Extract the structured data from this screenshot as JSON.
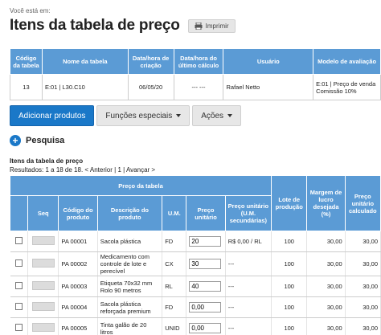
{
  "breadcrumb": "Você está em:",
  "page_title": "Itens da tabela de preço",
  "print_label": "Imprimir",
  "header_table": {
    "columns": [
      "Código da tabela",
      "Nome da tabela",
      "Data/hora de criação",
      "Data/hora do último cálculo",
      "Usuário",
      "Modelo de avaliação"
    ],
    "row": [
      "13",
      "E:01 | L30.C10",
      "06/05/20",
      "--- ---",
      "Rafael Netto",
      "E:01 | Preço de venda Comissão 10%"
    ]
  },
  "buttons": {
    "add": "Adicionar produtos",
    "special": "Funções especiais",
    "actions": "Ações"
  },
  "search_label": "Pesquisa",
  "section_title": "Itens da tabela de preço",
  "results": {
    "text": "Resultados: 1 a 18 de 18.",
    "prev": "< Anterior",
    "sep1": "|",
    "page": "1",
    "sep2": "|",
    "next": "Avançar >"
  },
  "main_table": {
    "group_header": "Preço da tabela",
    "columns": [
      "Seq",
      "Código do produto",
      "Descrição do produto",
      "U.M.",
      "Preço unitário",
      "Preço unitário (U.M. secundárias)",
      "Lote de produção",
      "Margem de lucro desejada (%)",
      "Preço unitário calculado"
    ],
    "rows": [
      {
        "code": "PA 00001",
        "desc": "Sacola plástica",
        "um": "FD",
        "price": "20",
        "price2": "R$ 0,00 / RL",
        "lote": "100",
        "margem": "30,00",
        "calc": "30,00"
      },
      {
        "code": "PA 00002",
        "desc": "Medicamento com controle de lote e perecível",
        "um": "CX",
        "price": "30",
        "price2": "---",
        "lote": "100",
        "margem": "30,00",
        "calc": "30,00"
      },
      {
        "code": "PA 00003",
        "desc": "Etiqueta 70x32 mm Rolo 90 metros",
        "um": "RL",
        "price": "40",
        "price2": "---",
        "lote": "100",
        "margem": "30,00",
        "calc": "30,00"
      },
      {
        "code": "PA 00004",
        "desc": "Sacola plástica reforçada premium",
        "um": "FD",
        "price": "0,00",
        "price2": "---",
        "lote": "100",
        "margem": "30,00",
        "calc": "30,00"
      },
      {
        "code": "PA 00005",
        "desc": "Tinta galão de 20 litros",
        "um": "UNID",
        "price": "0,00",
        "price2": "---",
        "lote": "100",
        "margem": "30,00",
        "calc": "30,00"
      }
    ]
  }
}
